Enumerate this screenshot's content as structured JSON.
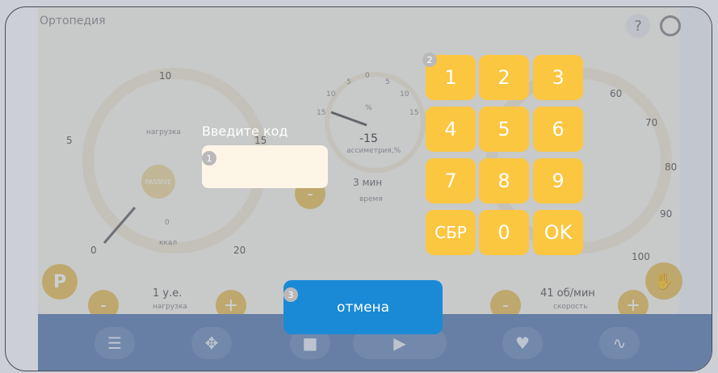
{
  "app": {
    "title": "Ортопедия"
  },
  "header_icons": {
    "help": "?",
    "settings": "gear-icon"
  },
  "left_gauge": {
    "ticks": [
      "10",
      "5",
      "15",
      "0",
      "20"
    ],
    "label_top": "нагрузка",
    "center": "PASSIVE",
    "bottom_value": "0",
    "bottom_label": "ккал",
    "control_value": "1 у.е.",
    "control_label": "нагрузка"
  },
  "middle_gauge": {
    "ticks": [
      "0",
      "5",
      "5",
      "10",
      "10",
      "15",
      "15"
    ],
    "unit": "%",
    "value": "-15",
    "value_label": "ассиметрия,%",
    "time_value": "3 мин",
    "time_label": "время"
  },
  "right_gauge": {
    "ticks": [
      "60",
      "70",
      "80",
      "90",
      "100"
    ],
    "control_value": "41 об/мин",
    "control_label": "скорость"
  },
  "minus_label": "-",
  "plus_label": "+",
  "bottom_bar": [
    "sliders-icon",
    "move-icon",
    "stop-icon",
    "play-icon",
    "heart-icon",
    "chart-icon"
  ],
  "dialog": {
    "prompt": "Введите код",
    "code_value": "",
    "badge1": "1",
    "badge2": "2",
    "badge3": "3",
    "keys": [
      "1",
      "2",
      "3",
      "4",
      "5",
      "6",
      "7",
      "8",
      "9",
      "СБР",
      "0",
      "OK"
    ],
    "cancel_label": "отмена"
  },
  "colors": {
    "key": "#fbc640",
    "cancel": "#1a8ad6",
    "bottom_band": "#5c7fb0"
  }
}
